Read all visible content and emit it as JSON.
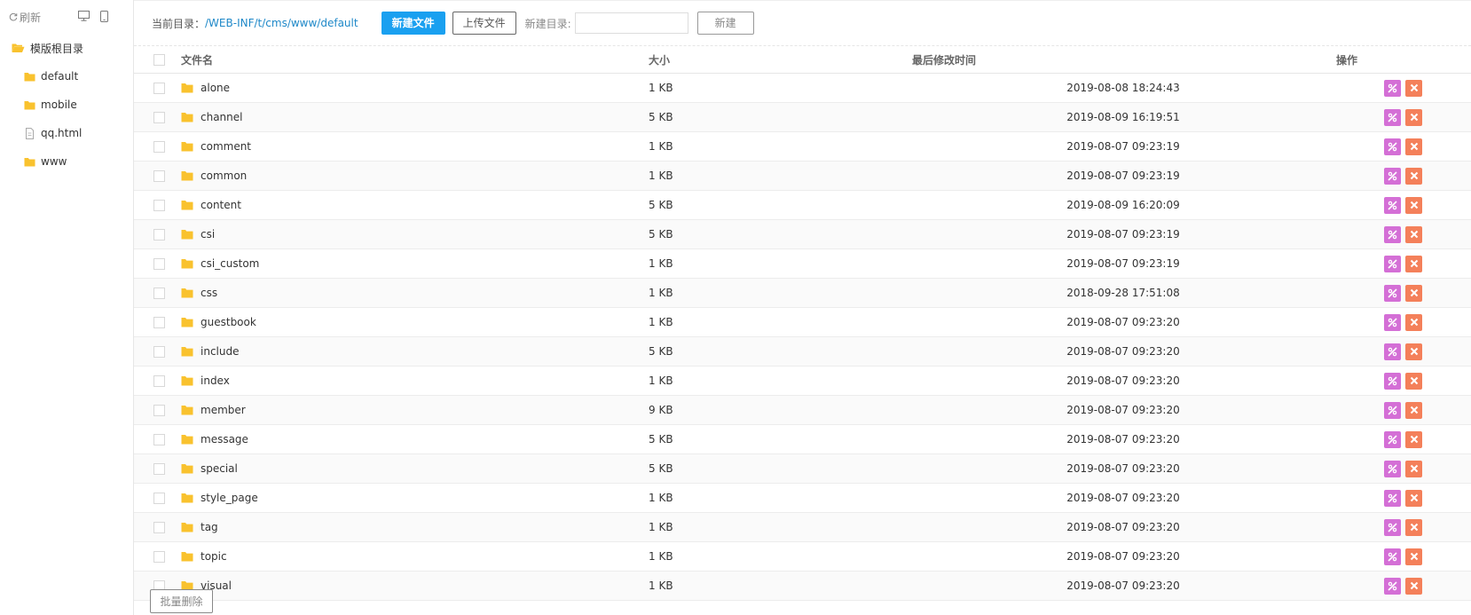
{
  "sidebar": {
    "refresh_label": "刷新",
    "root_label": "模版根目录",
    "items": [
      {
        "label": "default",
        "type": "folder"
      },
      {
        "label": "mobile",
        "type": "folder"
      },
      {
        "label": "qq.html",
        "type": "file"
      },
      {
        "label": "www",
        "type": "folder"
      }
    ]
  },
  "toolbar": {
    "current_dir_label": "当前目录：",
    "current_dir_path": "/WEB-INF/t/cms/www/default",
    "new_file_label": "新建文件",
    "upload_label": "上传文件",
    "new_dir_label": "新建目录:",
    "new_dir_value": "",
    "create_label": "新建"
  },
  "table": {
    "headers": {
      "name": "文件名",
      "size": "大小",
      "modified": "最后修改时间",
      "actions": "操作"
    },
    "rows": [
      {
        "name": "alone",
        "size": "1 KB",
        "modified": "2019-08-08 18:24:43"
      },
      {
        "name": "channel",
        "size": "5 KB",
        "modified": "2019-08-09 16:19:51"
      },
      {
        "name": "comment",
        "size": "1 KB",
        "modified": "2019-08-07 09:23:19"
      },
      {
        "name": "common",
        "size": "1 KB",
        "modified": "2019-08-07 09:23:19"
      },
      {
        "name": "content",
        "size": "5 KB",
        "modified": "2019-08-09 16:20:09"
      },
      {
        "name": "csi",
        "size": "5 KB",
        "modified": "2019-08-07 09:23:19"
      },
      {
        "name": "csi_custom",
        "size": "1 KB",
        "modified": "2019-08-07 09:23:19"
      },
      {
        "name": "css",
        "size": "1 KB",
        "modified": "2018-09-28 17:51:08"
      },
      {
        "name": "guestbook",
        "size": "1 KB",
        "modified": "2019-08-07 09:23:20"
      },
      {
        "name": "include",
        "size": "5 KB",
        "modified": "2019-08-07 09:23:20"
      },
      {
        "name": "index",
        "size": "1 KB",
        "modified": "2019-08-07 09:23:20"
      },
      {
        "name": "member",
        "size": "9 KB",
        "modified": "2019-08-07 09:23:20"
      },
      {
        "name": "message",
        "size": "5 KB",
        "modified": "2019-08-07 09:23:20"
      },
      {
        "name": "special",
        "size": "5 KB",
        "modified": "2019-08-07 09:23:20"
      },
      {
        "name": "style_page",
        "size": "1 KB",
        "modified": "2019-08-07 09:23:20"
      },
      {
        "name": "tag",
        "size": "1 KB",
        "modified": "2019-08-07 09:23:20"
      },
      {
        "name": "topic",
        "size": "1 KB",
        "modified": "2019-08-07 09:23:20"
      },
      {
        "name": "visual",
        "size": "1 KB",
        "modified": "2019-08-07 09:23:20"
      }
    ]
  },
  "footer": {
    "batch_delete_label": "批量删除"
  },
  "colors": {
    "primary": "#1aa0f0",
    "folder": "#f9c22e",
    "rename": "#d46fd6",
    "delete": "#f4805a",
    "path_link": "#1e88c8"
  },
  "icons": {
    "refresh": "refresh-icon",
    "desktop": "desktop-icon",
    "mobile": "mobile-icon",
    "folder": "folder-icon",
    "folder_open": "folder-open-icon",
    "file": "file-icon",
    "rename": "rename-icon",
    "delete": "close-icon"
  }
}
